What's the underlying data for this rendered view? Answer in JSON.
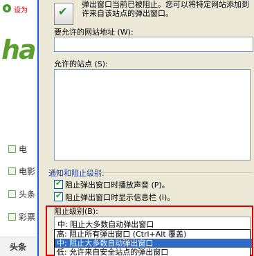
{
  "background_page": {
    "set_home": "设为",
    "logo_text": "ha",
    "nav_items": [
      "电",
      "电影",
      "头条",
      "彩票"
    ],
    "bottom_tab": "头条"
  },
  "dialog": {
    "intro_line1": "弹出窗口当前已被阻止。您可以将特定网站添加到",
    "intro_line2": "许来自该站点的弹出窗口。",
    "address_label": "要允许的网站地址 (W):",
    "address_value": "",
    "allowed_label": "允许的站点 (S):",
    "allowed_sites": [],
    "group_label": "通知和阻止级别:",
    "checkbox_sound": {
      "label": "阻止弹出窗口时播放声音 (P)。",
      "checked": true
    },
    "checkbox_infobar": {
      "label": "阻止弹出窗口时显示信息栏 (I)。",
      "checked": true
    },
    "block_level_label": "阻止级别(B):",
    "block_level_value": "中: 阻止大多数自动弹出窗口",
    "block_level_options": [
      "高: 阻止所有弹出窗口 (Ctrl+Alt 覆盖)",
      "中: 阻止大多数自动弹出窗口",
      "低: 允许来自安全站点的弹出窗口"
    ],
    "selected_option_index": 1
  },
  "colors": {
    "dialog_bg": "#ece9d8",
    "selection": "#316ac5",
    "highlight_border": "#e00000",
    "window_edge": "#1c5de0"
  }
}
